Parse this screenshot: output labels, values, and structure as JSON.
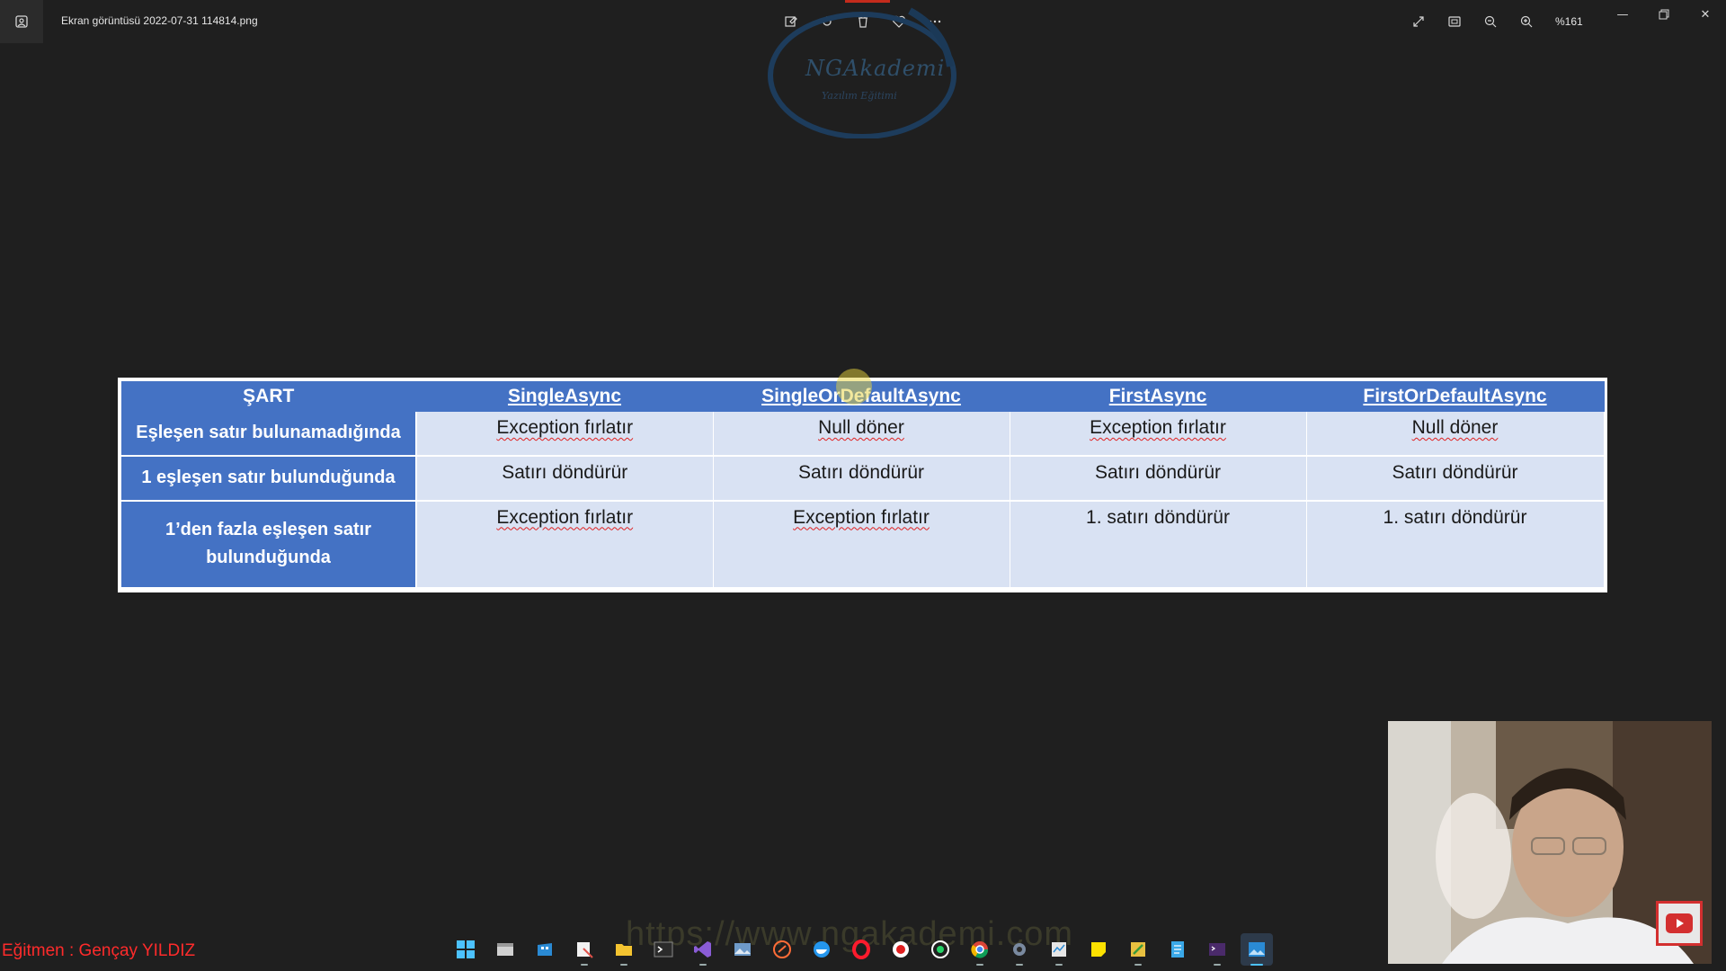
{
  "window": {
    "file_title": "Ekran görüntüsü 2022-07-31 114814.png",
    "zoom_level": "%161"
  },
  "toolbar": {
    "icons": [
      "edit-image-icon",
      "rotate-icon",
      "delete-icon",
      "favorite-icon",
      "more-icon"
    ]
  },
  "logo": {
    "name": "NGAkademi",
    "tagline": "Yazılım Eğitimi"
  },
  "table": {
    "headers": [
      "ŞART",
      "SingleAsync",
      "SingleOrDefaultAsync",
      "FirstAsync",
      "FirstOrDefaultAsync"
    ],
    "rows": [
      {
        "condition": "Eşleşen satır bulunamadığında",
        "cells": [
          "Exception fırlatır",
          "Null döner",
          "Exception fırlatır",
          "Null döner"
        ]
      },
      {
        "condition": "1 eşleşen satır bulunduğunda",
        "cells": [
          "Satırı döndürür",
          "Satırı döndürür",
          "Satırı döndürür",
          "Satırı döndürür"
        ]
      },
      {
        "condition": "1’den fazla eşleşen satır bulunduğunda",
        "cells": [
          "Exception fırlatır",
          "Exception fırlatır",
          "1. satırı döndürür",
          "1. satırı döndürür"
        ]
      }
    ]
  },
  "overlay": {
    "trainer": "Eğitmen : Gençay YILDIZ",
    "url": "https://www.ngakademi.com"
  },
  "taskbar": {
    "apps": [
      "windows-start-icon",
      "file-manager-icon",
      "store-icon",
      "snipping-tool-icon",
      "file-explorer-icon",
      "terminal-icon",
      "visual-studio-icon",
      "photos-icon",
      "postman-icon",
      "docker-icon",
      "opera-icon",
      "recorder-icon",
      "whatsapp-icon",
      "chrome-icon",
      "settings-icon",
      "task-manager-icon",
      "sticky-notes-icon",
      "paint-icon",
      "notepad-icon",
      "terminal-purple-icon",
      "photo-viewer-icon"
    ]
  },
  "colors": {
    "header_blue": "#4472c4",
    "cell_light": "#d9e2f3",
    "trainer_red": "#ff2b2b"
  }
}
